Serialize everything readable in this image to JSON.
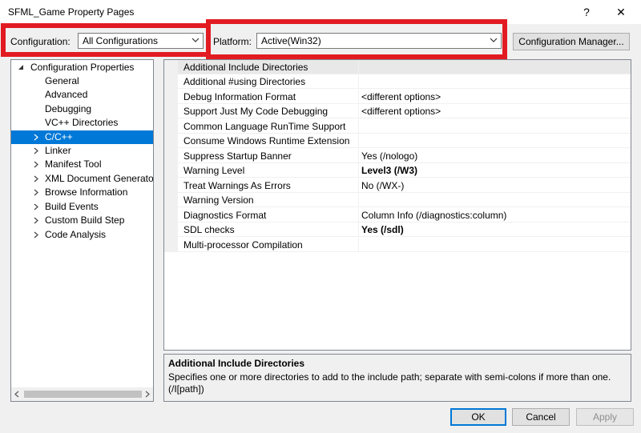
{
  "window": {
    "title": "SFML_Game Property Pages",
    "help_glyph": "?",
    "close_glyph": "✕"
  },
  "toolbar": {
    "configuration_label": "Configuration:",
    "configuration_value": "All Configurations",
    "platform_label": "Platform:",
    "platform_value": "Active(Win32)",
    "config_manager_label": "Configuration Manager..."
  },
  "tree": {
    "root": "Configuration Properties",
    "items": [
      {
        "label": "General"
      },
      {
        "label": "Advanced"
      },
      {
        "label": "Debugging"
      },
      {
        "label": "VC++ Directories"
      },
      {
        "label": "C/C++"
      },
      {
        "label": "Linker"
      },
      {
        "label": "Manifest Tool"
      },
      {
        "label": "XML Document Generator"
      },
      {
        "label": "Browse Information"
      },
      {
        "label": "Build Events"
      },
      {
        "label": "Custom Build Step"
      },
      {
        "label": "Code Analysis"
      }
    ]
  },
  "properties": [
    {
      "name": "Additional Include Directories",
      "value": ""
    },
    {
      "name": "Additional #using Directories",
      "value": ""
    },
    {
      "name": "Debug Information Format",
      "value": "<different options>"
    },
    {
      "name": "Support Just My Code Debugging",
      "value": "<different options>"
    },
    {
      "name": "Common Language RunTime Support",
      "value": ""
    },
    {
      "name": "Consume Windows Runtime Extension",
      "value": ""
    },
    {
      "name": "Suppress Startup Banner",
      "value": "Yes (/nologo)"
    },
    {
      "name": "Warning Level",
      "value": "Level3 (/W3)"
    },
    {
      "name": "Treat Warnings As Errors",
      "value": "No (/WX-)"
    },
    {
      "name": "Warning Version",
      "value": ""
    },
    {
      "name": "Diagnostics Format",
      "value": "Column Info (/diagnostics:column)"
    },
    {
      "name": "SDL checks",
      "value": "Yes (/sdl)"
    },
    {
      "name": "Multi-processor Compilation",
      "value": ""
    }
  ],
  "description": {
    "title": "Additional Include Directories",
    "text": "Specifies one or more directories to add to the include path; separate with semi-colons if more than one. (/I[path])"
  },
  "buttons": {
    "ok": "OK",
    "cancel": "Cancel",
    "apply": "Apply"
  },
  "colors": {
    "highlight_box": "#e21b22",
    "selection": "#0078d7"
  }
}
